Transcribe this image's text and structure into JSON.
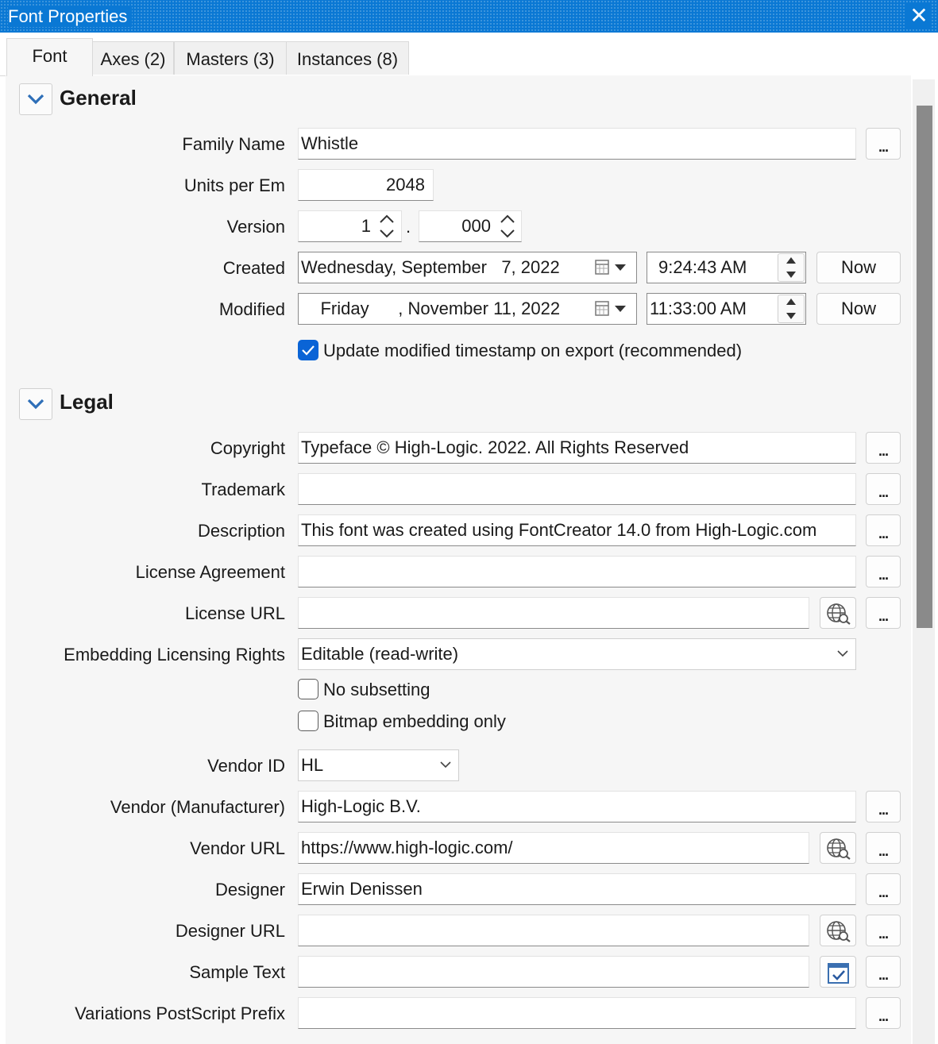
{
  "window": {
    "title": "Font Properties",
    "close_glyph": "✕"
  },
  "tabs": [
    {
      "label": "Font"
    },
    {
      "label": "Axes (2)"
    },
    {
      "label": "Masters (3)"
    },
    {
      "label": "Instances (8)"
    }
  ],
  "general": {
    "title": "General",
    "family_name": {
      "label": "Family Name",
      "value": "Whistle"
    },
    "units_per_em": {
      "label": "Units per Em",
      "value": "2048"
    },
    "version": {
      "label": "Version",
      "major": "1",
      "separator": ".",
      "minor": "000"
    },
    "created": {
      "label": "Created",
      "date": "Wednesday, September   7, 2022",
      "time": "9:24:43 AM",
      "now_label": "Now"
    },
    "modified": {
      "label": "Modified",
      "date": "    Friday      , November 11, 2022",
      "time": "11:33:00 AM",
      "now_label": "Now"
    },
    "update_timestamp": {
      "label": "Update modified timestamp on export (recommended)",
      "checked": true
    }
  },
  "legal": {
    "title": "Legal",
    "copyright": {
      "label": "Copyright",
      "value": "Typeface © High-Logic. 2022. All Rights Reserved"
    },
    "trademark": {
      "label": "Trademark",
      "value": ""
    },
    "description": {
      "label": "Description",
      "value": "This font was created using FontCreator 14.0 from High-Logic.com"
    },
    "license_agreement": {
      "label": "License Agreement",
      "value": ""
    },
    "license_url": {
      "label": "License URL",
      "value": ""
    },
    "embedding": {
      "label": "Embedding Licensing Rights",
      "value": "Editable (read-write)"
    },
    "no_subsetting": {
      "label": "No subsetting",
      "checked": false
    },
    "bitmap_only": {
      "label": "Bitmap embedding only",
      "checked": false
    },
    "vendor_id": {
      "label": "Vendor ID",
      "value": "HL"
    },
    "vendor": {
      "label": "Vendor (Manufacturer)",
      "value": "High-Logic B.V."
    },
    "vendor_url": {
      "label": "Vendor URL",
      "value": "https://www.high-logic.com/"
    },
    "designer": {
      "label": "Designer",
      "value": "Erwin Denissen"
    },
    "designer_url": {
      "label": "Designer URL",
      "value": ""
    },
    "sample_text": {
      "label": "Sample Text",
      "value": ""
    },
    "variations_prefix": {
      "label": "Variations PostScript Prefix",
      "value": ""
    }
  },
  "ellipsis_label": "...",
  "colors": {
    "accent": "#0a78d4",
    "checkbox": "#0a64d6",
    "panel": "#f6f6f6"
  }
}
